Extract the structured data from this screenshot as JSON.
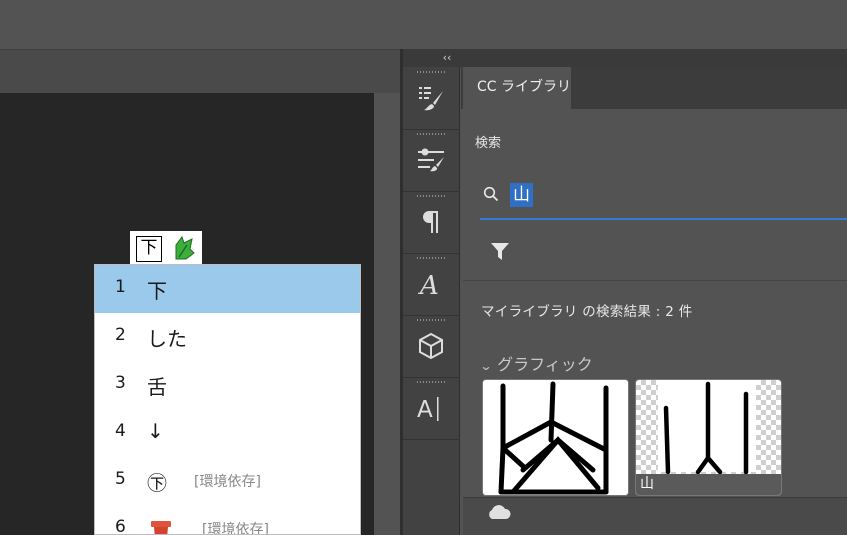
{
  "panel": {
    "tab_label": "CC ライブラリ",
    "search_heading": "検索",
    "search_value": "山",
    "results_text": "マイライブラリ の検索結果 : 2 件",
    "graphics_header": "グラフィック",
    "thumbnails": [
      {
        "label": "",
        "icon": "mountain-glyph-bold"
      },
      {
        "label": "山",
        "icon": "mountain-glyph-brush"
      }
    ]
  },
  "collapse_label": "‹‹",
  "tools": [
    {
      "icon": "brush-presets-icon"
    },
    {
      "icon": "brush-settings-icon"
    },
    {
      "icon": "paragraph-icon"
    },
    {
      "icon": "character-styles-icon"
    },
    {
      "icon": "3d-cube-icon"
    },
    {
      "icon": "glyphs-icon"
    }
  ],
  "ime": {
    "indicator_char": "下",
    "candidates": [
      {
        "num": "1",
        "text": "下",
        "note": "",
        "selected": true
      },
      {
        "num": "2",
        "text": "した",
        "note": ""
      },
      {
        "num": "3",
        "text": "舌",
        "note": ""
      },
      {
        "num": "4",
        "text": "↓",
        "note": ""
      },
      {
        "num": "5",
        "text": "㊦",
        "note": "[環境依存]"
      },
      {
        "num": "6",
        "text": "",
        "note": "[環境依存]",
        "icon": "red-pot-icon"
      }
    ]
  },
  "colors": {
    "accent": "#2f7bd6",
    "selection": "#9bc9ec",
    "panel_bg": "#535353"
  }
}
